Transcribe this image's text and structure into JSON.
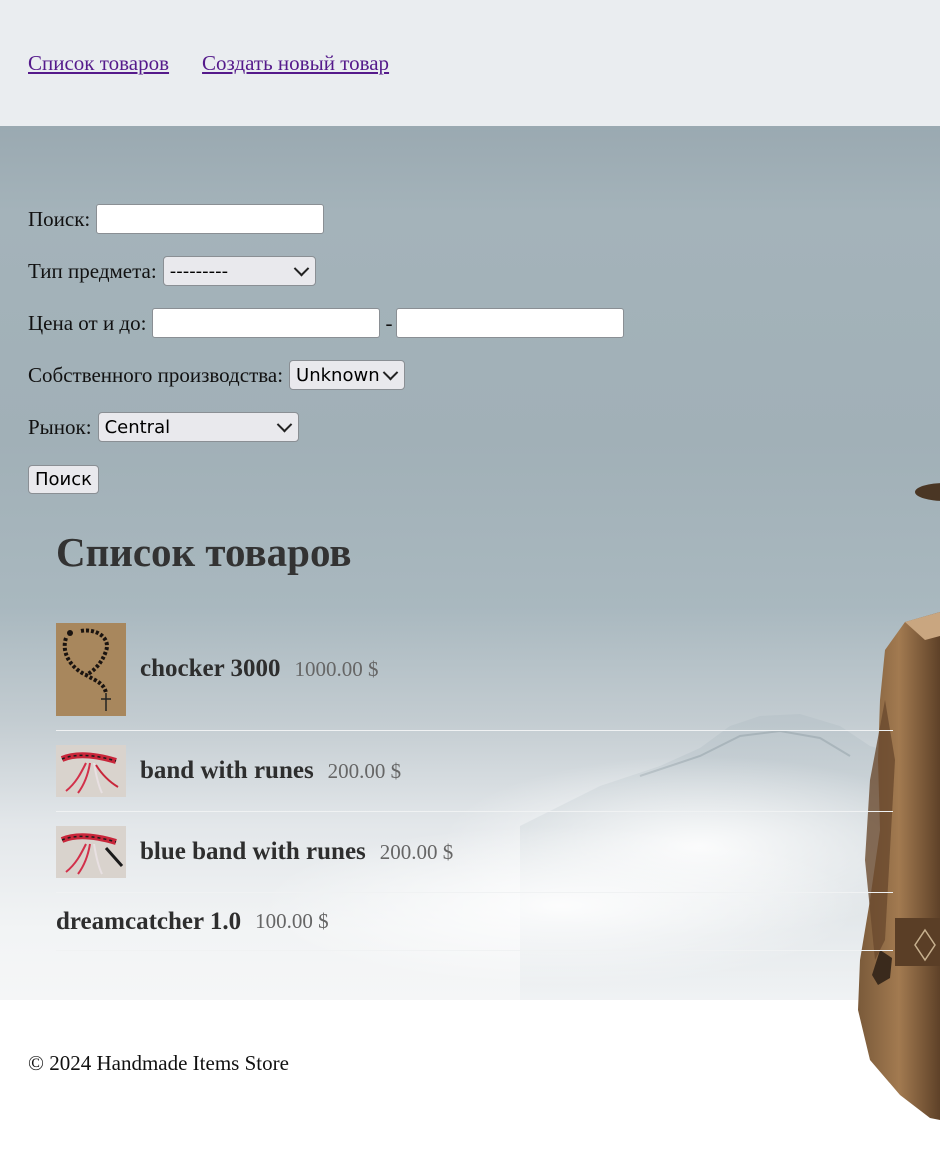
{
  "nav": {
    "items": [
      {
        "label": "Список товаров"
      },
      {
        "label": "Создать новый товар"
      }
    ]
  },
  "filters": {
    "search_label": "Поиск:",
    "search_value": "",
    "type_label": "Тип предмета:",
    "type_value": "---------",
    "price_label": "Цена от и до:",
    "price_separator": "-",
    "price_from": "",
    "price_to": "",
    "own_label": "Собственного производства:",
    "own_value": "Unknown",
    "market_label": "Рынок:",
    "market_value": "Central",
    "submit_label": "Поиск"
  },
  "list": {
    "title": "Список товаров",
    "products": [
      {
        "name": "chocker 3000",
        "price": "1000.00 $",
        "thumb_icon": "rosary-photo"
      },
      {
        "name": "band with runes",
        "price": "200.00 $",
        "thumb_icon": "red-band-photo"
      },
      {
        "name": "blue band with runes",
        "price": "200.00 $",
        "thumb_icon": "red-band-photo"
      },
      {
        "name": "dreamcatcher 1.0",
        "price": "100.00 $",
        "thumb_icon": ""
      }
    ]
  },
  "footer": {
    "text": "© 2024 Handmade Items Store"
  },
  "colors": {
    "header_bg": "#eaedf0",
    "link": "#551a8b",
    "title": "#333333",
    "price": "#666666"
  }
}
